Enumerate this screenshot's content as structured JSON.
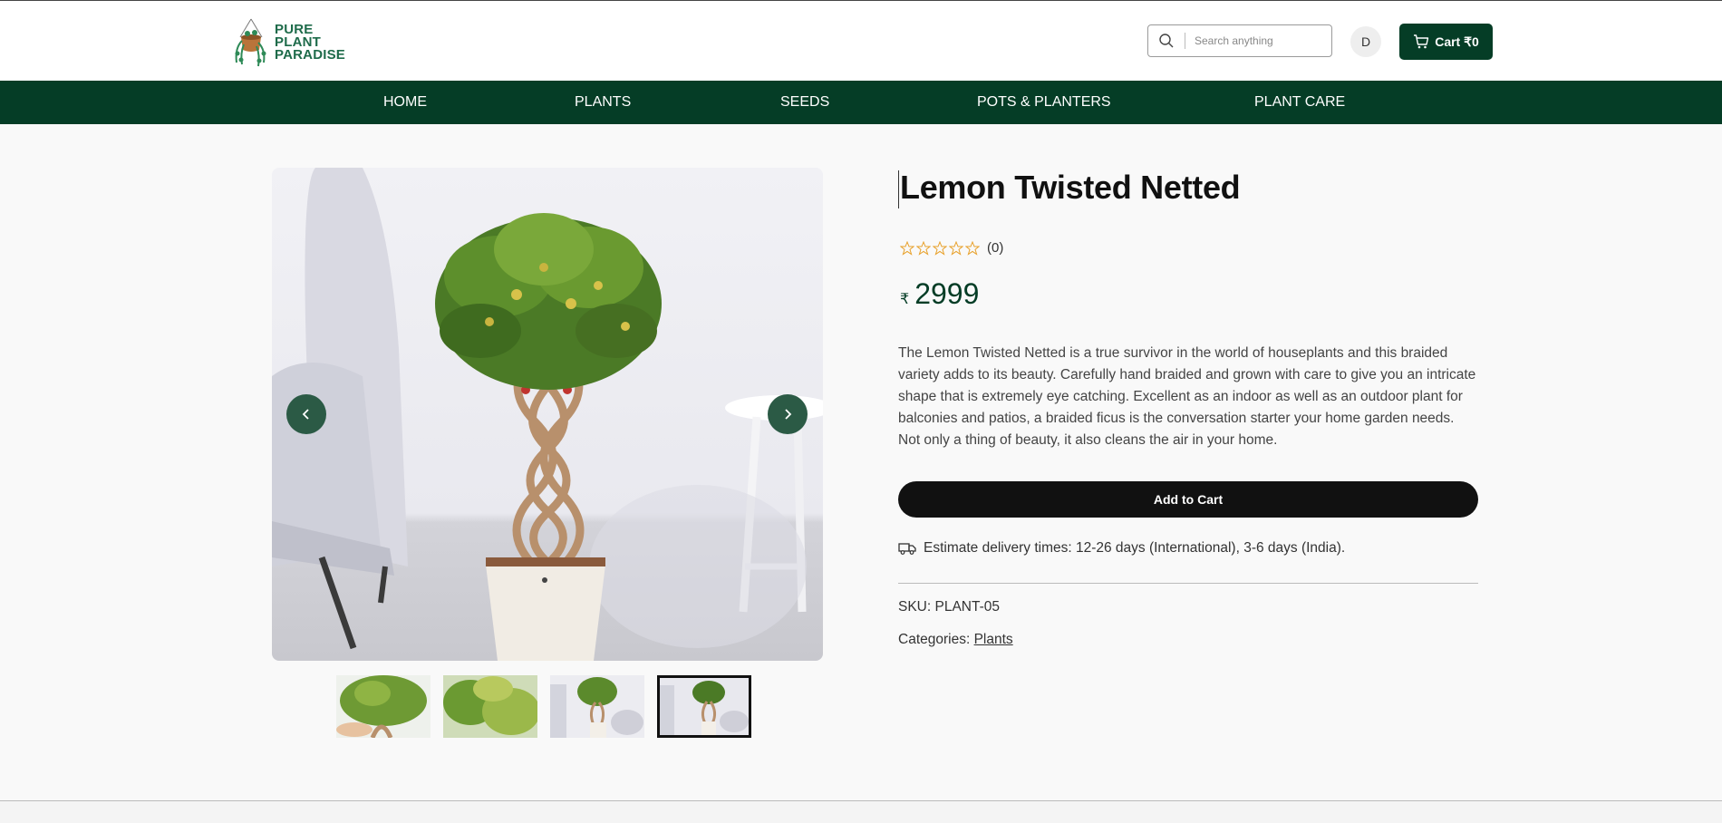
{
  "brand": {
    "logo_lines": [
      "PURE",
      "PLANT",
      "PARADISE"
    ],
    "color": "#1e6b4a"
  },
  "header": {
    "search_placeholder": "Search anything",
    "avatar_initial": "D",
    "cart_label": "Cart ₹0"
  },
  "nav": {
    "background": "#053d26",
    "items": [
      "HOME",
      "PLANTS",
      "SEEDS",
      "POTS & PLANTERS",
      "PLANT CARE"
    ]
  },
  "gallery": {
    "thumbnail_count": 4,
    "active_thumbnail": 4,
    "icons": [
      "chevron-left-icon",
      "chevron-right-icon"
    ]
  },
  "product": {
    "title": "Lemon Twisted Netted",
    "rating_stars": 0,
    "rating_max": 5,
    "review_count": "(0)",
    "currency": "₹",
    "price": "2999",
    "description": "The Lemon Twisted Netted is a true survivor in the world of houseplants and this braided variety adds to its beauty. Carefully hand braided and grown with care to give you an intricate shape that is extremely eye catching. Excellent as an indoor as well as an outdoor plant for balconies and patios, a braided ficus is the conversation starter your home garden needs. Not only a thing of beauty, it also cleans the air in your home.",
    "add_to_cart": "Add to Cart",
    "delivery": "Estimate delivery times: 12-26 days (International), 3-6 days (India).",
    "sku_label": "SKU: ",
    "sku": "PLANT-05",
    "categories_label": "Categories: ",
    "category": "Plants",
    "star_color": "#e8a12b"
  }
}
